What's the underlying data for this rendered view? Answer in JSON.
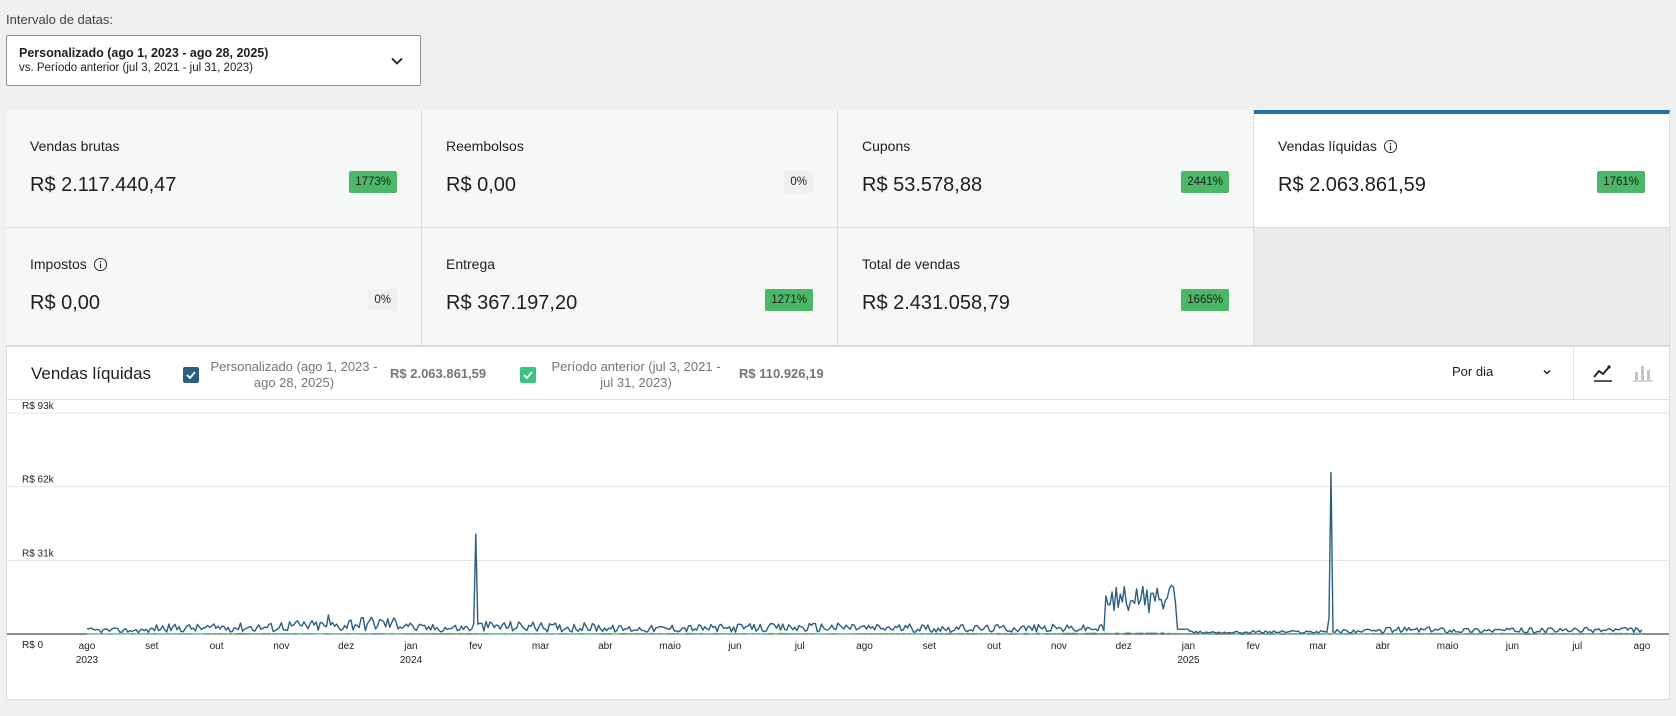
{
  "date_range": {
    "label": "Intervalo de datas:",
    "primary": "Personalizado (ago 1, 2023 - ago 28, 2025)",
    "secondary": "vs. Período anterior (jul 3, 2021 - jul 31, 2023)"
  },
  "cards": [
    {
      "title": "Vendas brutas",
      "value": "R$ 2.117.440,47",
      "delta": "1773%",
      "info": false,
      "active": false
    },
    {
      "title": "Reembolsos",
      "value": "R$ 0,00",
      "delta": "0%",
      "info": false,
      "active": false
    },
    {
      "title": "Cupons",
      "value": "R$ 53.578,88",
      "delta": "2441%",
      "info": false,
      "active": false
    },
    {
      "title": "Vendas líquidas",
      "value": "R$ 2.063.861,59",
      "delta": "1761%",
      "info": true,
      "active": true
    },
    {
      "title": "Impostos",
      "value": "R$ 0,00",
      "delta": "0%",
      "info": true,
      "active": false
    },
    {
      "title": "Entrega",
      "value": "R$ 367.197,20",
      "delta": "1271%",
      "info": false,
      "active": false
    },
    {
      "title": "Total de vendas",
      "value": "R$ 2.431.058,79",
      "delta": "1665%",
      "info": false,
      "active": false
    }
  ],
  "colors": {
    "accent": "#2271b1",
    "series_primary": "#2b5f80",
    "series_previous": "#3cc383",
    "positive_badge": "#4ab866"
  },
  "chart_header": {
    "title": "Vendas líquidas",
    "legend": [
      {
        "line1": "Personalizado (ago 1, 2023 -",
        "line2": "ago 28, 2025)",
        "total": "R$ 2.063.861,59",
        "color": "#2b5f80"
      },
      {
        "line1": "Período anterior (jul 3, 2021 -",
        "line2": "jul 31, 2023)",
        "total": "R$ 110.926,19",
        "color": "#3cc383"
      }
    ],
    "interval": "Por dia",
    "chart_types": [
      "line-chart-icon",
      "bar-chart-icon"
    ]
  },
  "chart_data": {
    "type": "line",
    "y_ticks": [
      "R$ 93k",
      "R$ 62k",
      "R$ 31k",
      "R$ 0"
    ],
    "ylim": [
      0,
      93000
    ],
    "x_ticks": [
      {
        "label": "ago",
        "year": "2023"
      },
      {
        "label": "set"
      },
      {
        "label": "out"
      },
      {
        "label": "nov"
      },
      {
        "label": "dez"
      },
      {
        "label": "jan",
        "year": "2024"
      },
      {
        "label": "fev"
      },
      {
        "label": "mar"
      },
      {
        "label": "abr"
      },
      {
        "label": "maio"
      },
      {
        "label": "jun"
      },
      {
        "label": "jul"
      },
      {
        "label": "ago"
      },
      {
        "label": "set"
      },
      {
        "label": "out"
      },
      {
        "label": "nov"
      },
      {
        "label": "dez"
      },
      {
        "label": "jan",
        "year": "2025"
      },
      {
        "label": "fev"
      },
      {
        "label": "mar"
      },
      {
        "label": "abr"
      },
      {
        "label": "maio"
      },
      {
        "label": "jun"
      },
      {
        "label": "jul"
      },
      {
        "label": "ago"
      }
    ],
    "series": [
      {
        "name": "Personalizado (ago 1, 2023 - ago 28, 2025)",
        "color": "#2b5f80",
        "values_by_month": [
          1500,
          2500,
          2800,
          3500,
          4500,
          2500,
          3200,
          2800,
          2200,
          2400,
          2600,
          2800,
          2500,
          2300,
          2400,
          2300,
          14000,
          700,
          900,
          1200,
          1800,
          1600,
          1500,
          1700,
          1800
        ],
        "peaks": [
          {
            "month": "nov 2023",
            "value": 8000
          },
          {
            "month": "fev 2024",
            "value": 42000
          },
          {
            "month": "dez 2024",
            "value": 20000
          },
          {
            "month": "mar 2025",
            "value": 68000
          }
        ]
      },
      {
        "name": "Período anterior (jul 3, 2021 - jul 31, 2023)",
        "color": "#3cc383",
        "values_by_month": [
          100,
          120,
          150,
          130,
          140,
          150,
          130,
          140,
          150,
          160,
          150,
          140,
          150,
          180,
          200,
          250,
          300,
          200,
          150,
          160,
          170,
          180,
          190,
          200,
          210
        ]
      }
    ]
  }
}
